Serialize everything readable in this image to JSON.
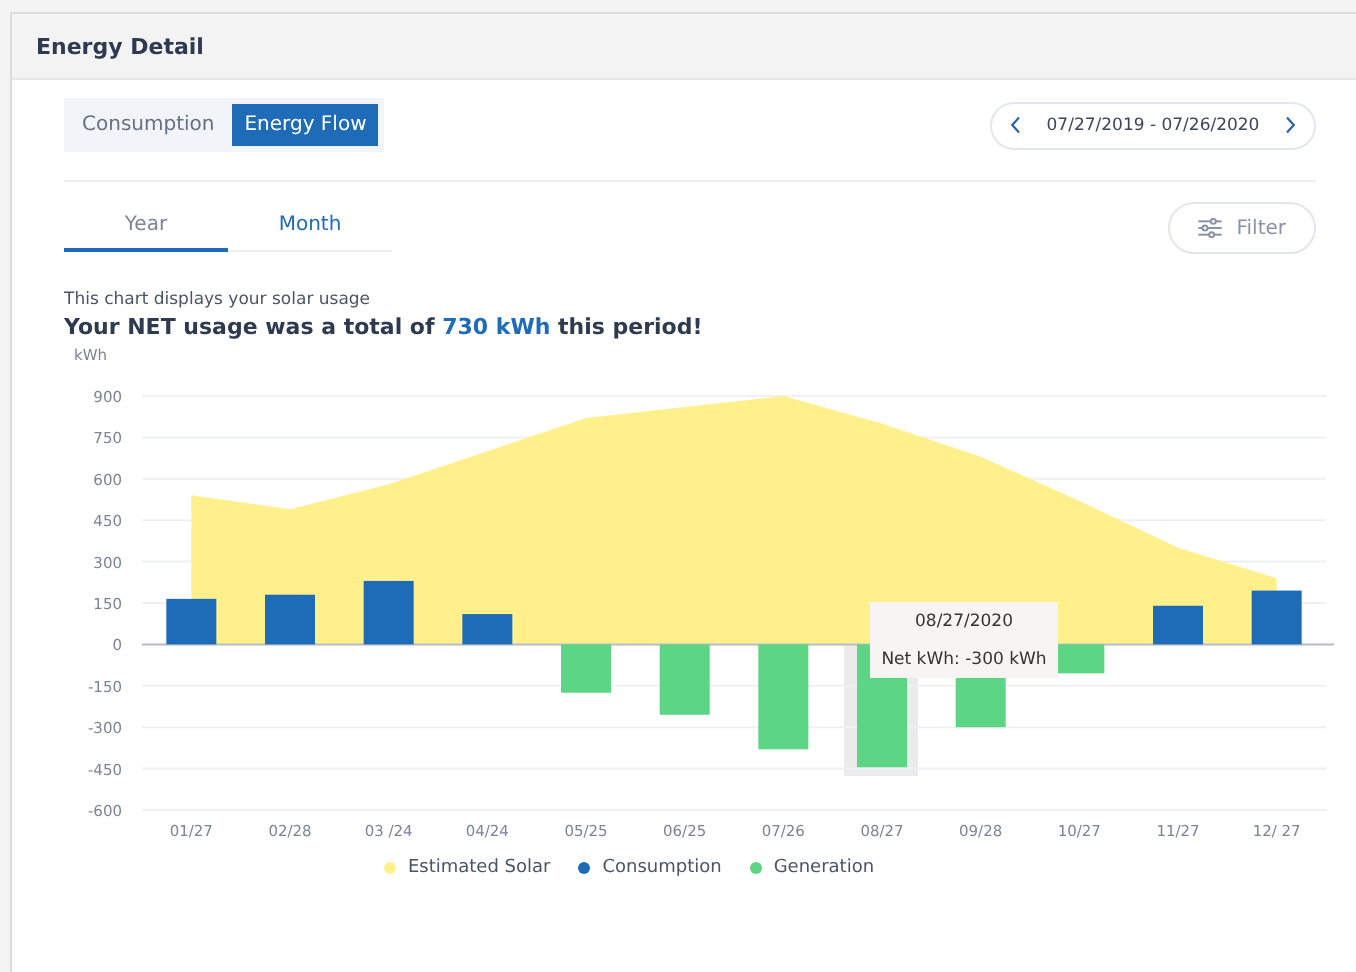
{
  "panel": {
    "title": "Energy Detail"
  },
  "view_toggle": [
    {
      "label": "Consumption",
      "selected": false
    },
    {
      "label": "Energy Flow",
      "selected": true
    }
  ],
  "date_range": {
    "text": "07/27/2019 - 07/26/2020"
  },
  "period_tabs": [
    {
      "label": "Year",
      "selected": true
    },
    {
      "label": "Month",
      "selected": false
    }
  ],
  "filter_button": {
    "label": "Filter"
  },
  "caption": "This chart displays your solar usage",
  "headline": {
    "before": "Your NET usage was a total of ",
    "value": "730 kWh",
    "after": " this period!"
  },
  "chart": {
    "chart_data": {
      "type": "bar",
      "ylabel": "kWh",
      "categories": [
        "01/27",
        "02/28",
        "03 /24",
        "04/24",
        "05/25",
        "06/25",
        "07/26",
        "08/27",
        "09/28",
        "10/27",
        "11/27",
        "12/ 27"
      ],
      "stacked": true,
      "grid": true,
      "ylim": [
        -600,
        900
      ],
      "yticks": [
        900,
        750,
        600,
        450,
        300,
        150,
        0,
        -150,
        -300,
        -450,
        -600
      ],
      "series": [
        {
          "name": "Estimated Solar",
          "type": "area",
          "color": "#fff08c",
          "values": [
            540,
            490,
            580,
            700,
            820,
            860,
            900,
            800,
            680,
            520,
            350,
            240
          ]
        },
        {
          "name": "Consumption",
          "type": "bar",
          "color": "#1e6bb8",
          "values": [
            165,
            180,
            230,
            110,
            null,
            null,
            null,
            null,
            null,
            null,
            140,
            195
          ]
        },
        {
          "name": "Generation",
          "type": "bar",
          "color": "#5cd584",
          "values": [
            null,
            null,
            null,
            null,
            -175,
            -255,
            -380,
            -445,
            -300,
            -105,
            null,
            null
          ]
        }
      ]
    },
    "tooltip": {
      "title": "08/27/2020",
      "text": "Net kWh: -300 kWh"
    }
  }
}
